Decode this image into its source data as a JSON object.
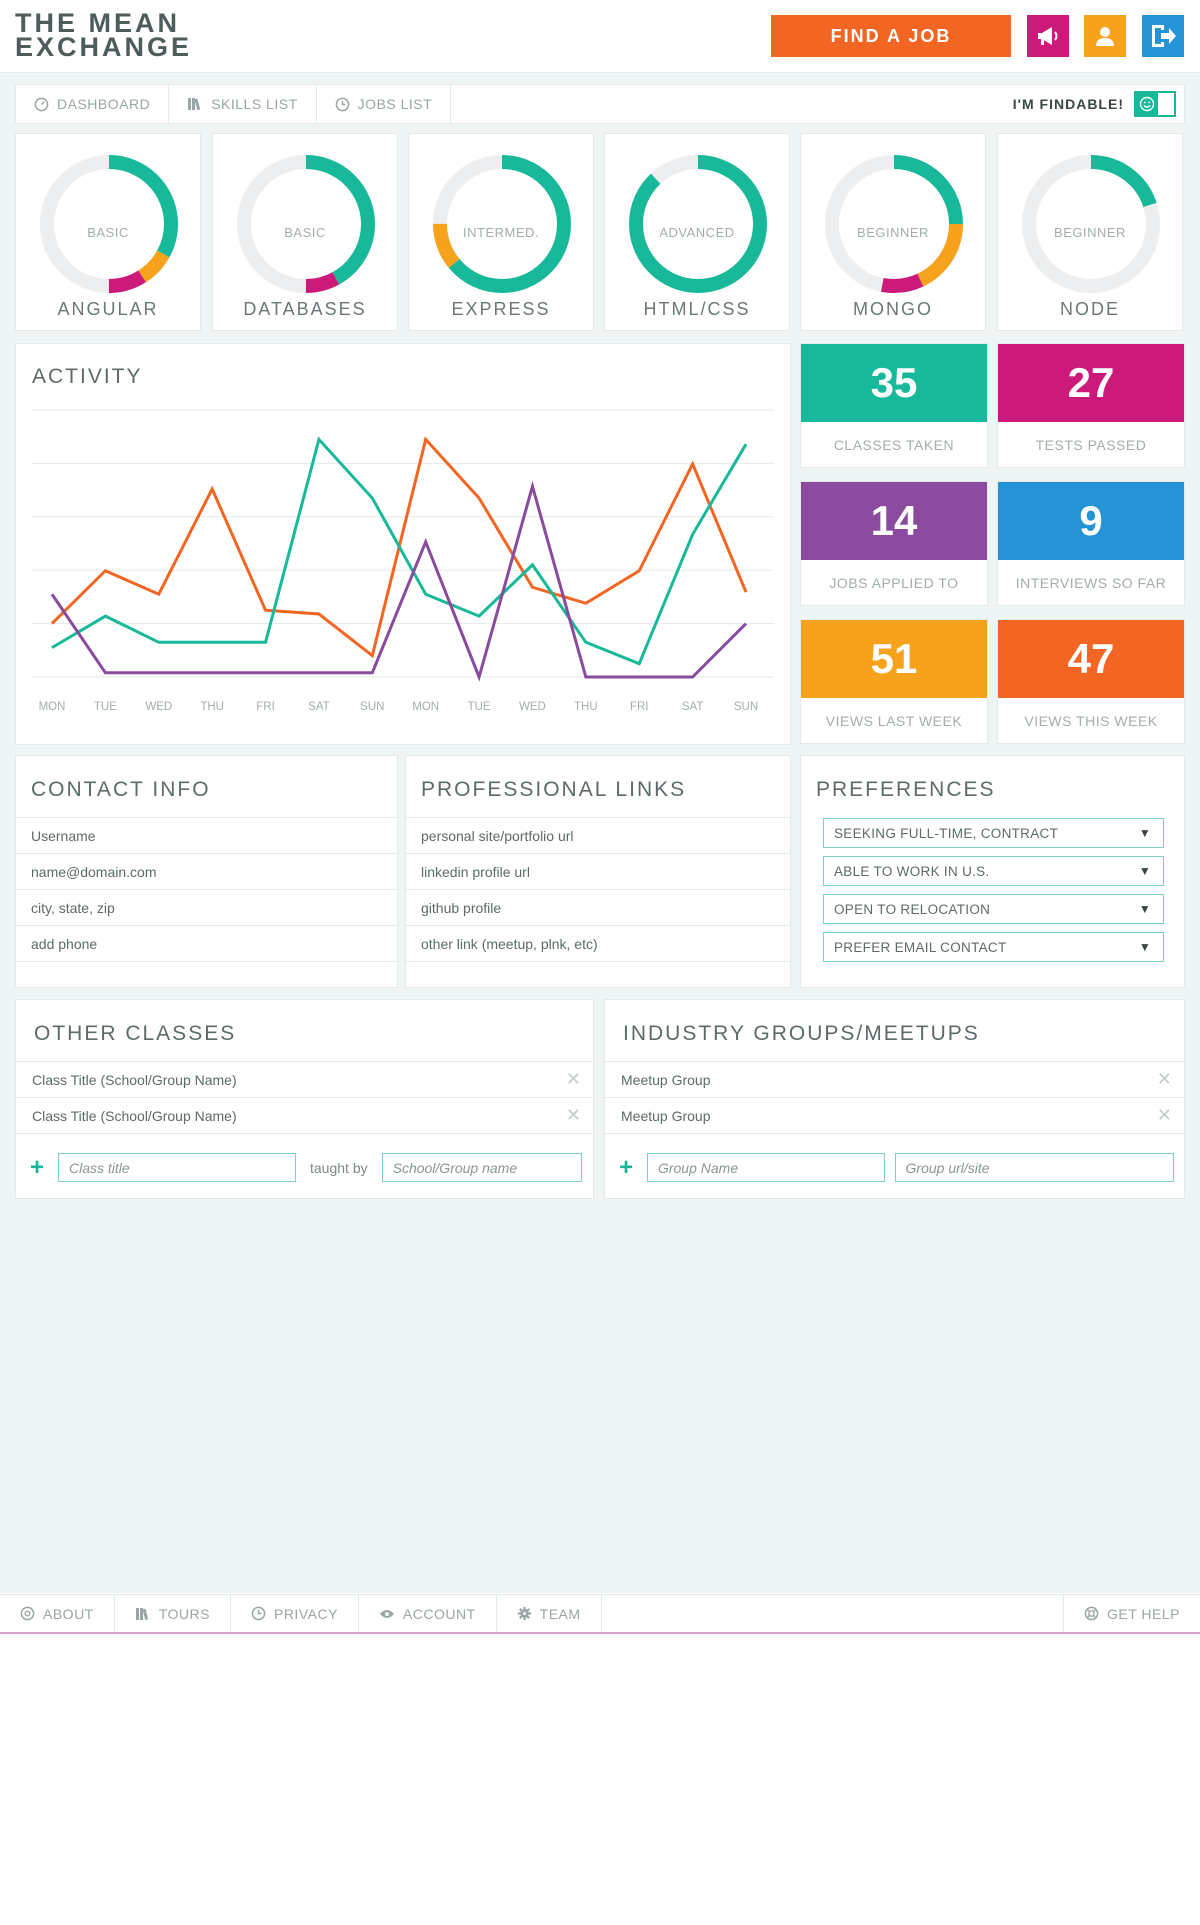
{
  "header": {
    "logo_line1": "THE MEAN",
    "logo_line2": "EXCHANGE",
    "find_job_label": "FIND A JOB"
  },
  "nav": {
    "items": [
      {
        "label": "DASHBOARD",
        "icon": "dashboard-icon"
      },
      {
        "label": "SKILLS LIST",
        "icon": "books-icon"
      },
      {
        "label": "JOBS LIST",
        "icon": "clock-icon"
      }
    ],
    "findable_label": "I'M FINDABLE!"
  },
  "skills": [
    {
      "name": "ANGULAR",
      "level": "BASIC",
      "segments": [
        {
          "color": "#18b99a",
          "frac": 0.33
        },
        {
          "color": "#f7a21c",
          "frac": 0.08
        },
        {
          "color": "#cc1a7a",
          "frac": 0.09
        }
      ]
    },
    {
      "name": "DATABASES",
      "level": "BASIC",
      "segments": [
        {
          "color": "#18b99a",
          "frac": 0.42
        },
        {
          "color": "#cc1a7a",
          "frac": 0.08
        }
      ]
    },
    {
      "name": "EXPRESS",
      "level": "INTERMED.",
      "segments": [
        {
          "color": "#18b99a",
          "frac": 0.64
        },
        {
          "color": "#f7a21c",
          "frac": 0.11
        }
      ]
    },
    {
      "name": "HTML/CSS",
      "level": "ADVANCED",
      "segments": [
        {
          "color": "#18b99a",
          "frac": 0.88
        }
      ]
    },
    {
      "name": "MONGO",
      "level": "BEGINNER",
      "segments": [
        {
          "color": "#18b99a",
          "frac": 0.25
        },
        {
          "color": "#f7a21c",
          "frac": 0.18
        },
        {
          "color": "#cc1a7a",
          "frac": 0.1
        }
      ]
    },
    {
      "name": "NODE",
      "level": "BEGINNER",
      "segments": [
        {
          "color": "#18b99a",
          "frac": 0.2
        }
      ]
    }
  ],
  "activity": {
    "title": "ACTIVITY",
    "chart_data": {
      "type": "line",
      "categories": [
        "MON",
        "TUE",
        "WED",
        "THU",
        "FRI",
        "SAT",
        "SUN",
        "MON",
        "TUE",
        "WED",
        "THU",
        "FRI",
        "SAT",
        "SUN"
      ],
      "ylim": [
        0,
        5
      ],
      "grid": true,
      "series": [
        {
          "color": "#f26522",
          "values": [
            1.0,
            1.99,
            1.55,
            3.52,
            1.25,
            1.18,
            0.4,
            4.45,
            3.35,
            1.68,
            1.38,
            1.99,
            3.99,
            1.59
          ]
        },
        {
          "color": "#18b99a",
          "values": [
            0.55,
            1.14,
            0.65,
            0.65,
            0.65,
            4.45,
            3.35,
            1.55,
            1.14,
            2.1,
            0.65,
            0.25,
            2.67,
            4.36
          ]
        },
        {
          "color": "#8a4a9e",
          "values": [
            1.55,
            0.08,
            0.08,
            0.08,
            0.08,
            0.08,
            0.08,
            2.53,
            0.0,
            3.57,
            0.0,
            0.0,
            0.0,
            1.0
          ]
        }
      ]
    }
  },
  "stats": [
    {
      "value": "35",
      "label": "CLASSES TAKEN",
      "color": "#18b99a"
    },
    {
      "value": "27",
      "label": "TESTS PASSED",
      "color": "#cc1a7a"
    },
    {
      "value": "14",
      "label": "JOBS APPLIED TO",
      "color": "#8a4a9e"
    },
    {
      "value": "9",
      "label": "INTERVIEWS SO FAR",
      "color": "#2593d6"
    },
    {
      "value": "51",
      "label": "VIEWS LAST WEEK",
      "color": "#f7a21c"
    },
    {
      "value": "47",
      "label": "VIEWS THIS WEEK",
      "color": "#f26522"
    }
  ],
  "contact": {
    "title": "CONTACT INFO",
    "rows": [
      "Username",
      "name@domain.com",
      "city, state, zip",
      "add phone"
    ]
  },
  "links": {
    "title": "PROFESSIONAL LINKS",
    "rows": [
      "personal site/portfolio url",
      "linkedin profile url",
      "github profile",
      "other link (meetup, plnk, etc)"
    ]
  },
  "preferences": {
    "title": "PREFERENCES",
    "selects": [
      "SEEKING FULL-TIME, CONTRACT",
      "ABLE TO WORK IN U.S.",
      "OPEN TO RELOCATION",
      "PREFER EMAIL CONTACT"
    ]
  },
  "classes": {
    "title": "OTHER CLASSES",
    "rows": [
      "Class Title (School/Group Name)",
      "Class Title (School/Group Name)"
    ],
    "class_placeholder": "Class title",
    "taught_by": "taught by",
    "school_placeholder": "School/Group name"
  },
  "groups": {
    "title": "INDUSTRY GROUPS/MEETUPS",
    "rows": [
      "Meetup Group",
      "Meetup Group"
    ],
    "name_placeholder": "Group Name",
    "url_placeholder": "Group url/site"
  },
  "footer": {
    "items": [
      {
        "label": "ABOUT",
        "icon": "help-icon"
      },
      {
        "label": "TOURS",
        "icon": "books-icon"
      },
      {
        "label": "PRIVACY",
        "icon": "clock-icon"
      },
      {
        "label": "ACCOUNT",
        "icon": "eye-icon"
      },
      {
        "label": "TEAM",
        "icon": "gear-icon"
      }
    ],
    "help_label": "GET HELP"
  }
}
